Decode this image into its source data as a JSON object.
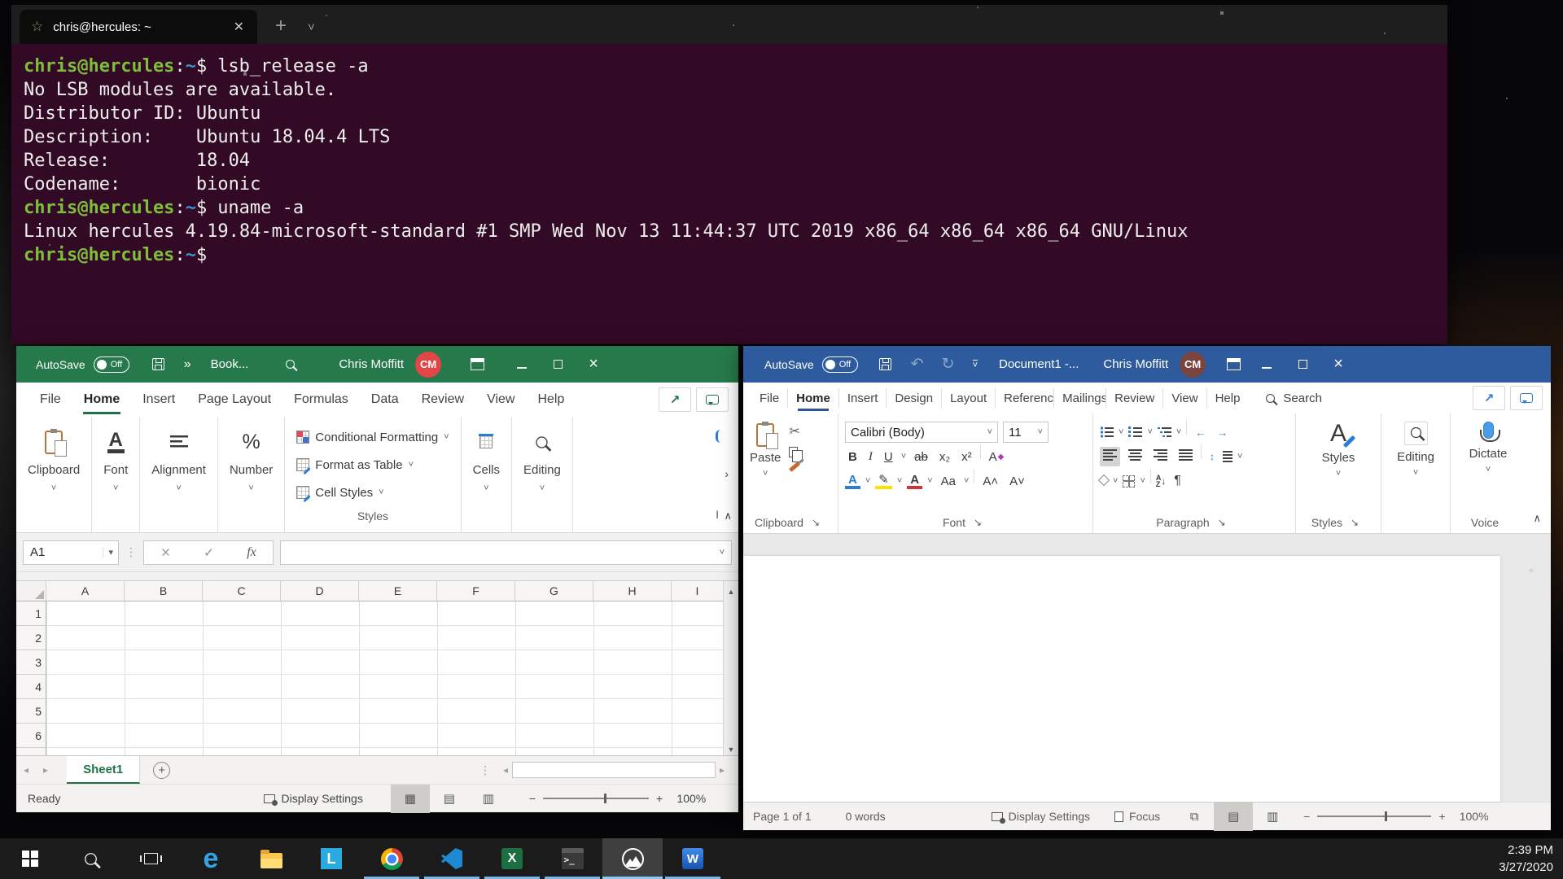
{
  "terminal": {
    "tab": {
      "title": "chris@hercules: ~",
      "close_glyph": "✕"
    },
    "newtab_glyph": "+",
    "menu_glyph": "˅",
    "prompt": {
      "user": "chris@hercules",
      "colon": ":",
      "path": "~",
      "symbol": "$"
    },
    "lines": [
      {
        "cmd": "lsb_release -a"
      },
      {
        "text": "No LSB modules are available."
      },
      {
        "text": "Distributor ID: Ubuntu"
      },
      {
        "text": "Description:    Ubuntu 18.04.4 LTS"
      },
      {
        "text": "Release:        18.04"
      },
      {
        "text": "Codename:       bionic"
      },
      {
        "cmd": "uname -a"
      },
      {
        "text": "Linux hercules 4.19.84-microsoft-standard #1 SMP Wed Nov 13 11:44:37 UTC 2019 x86_64 x86_64 x86_64 GNU/Linux"
      },
      {
        "cmd": ""
      }
    ]
  },
  "excel": {
    "accent": "#217346",
    "titlebar": {
      "autosave_label": "AutoSave",
      "autosave_state": "Off",
      "overflow_glyph": "»",
      "doc_title": "Book...",
      "user": "Chris Moffitt",
      "avatar": "CM",
      "avatar_color": "#e24649"
    },
    "tabs": [
      "File",
      "Home",
      "Insert",
      "Page Layout",
      "Formulas",
      "Data",
      "Review",
      "View",
      "Help"
    ],
    "ribbon": {
      "clipboard_label": "Clipboard",
      "font_label": "Font",
      "alignment_label": "Alignment",
      "number_label": "Number",
      "number_glyph": "%",
      "styles_buttons": [
        "Conditional Formatting",
        "Format as Table",
        "Cell Styles"
      ],
      "styles_group_label": "Styles",
      "cells_label": "Cells",
      "editing_label": "Editing",
      "overflow_label": "I"
    },
    "formula_bar": {
      "name_box": "A1",
      "cancel_glyph": "✕",
      "enter_glyph": "✓",
      "fx_glyph": "fx",
      "value": ""
    },
    "grid": {
      "columns": [
        "A",
        "B",
        "C",
        "D",
        "E",
        "F",
        "G",
        "H",
        "I"
      ],
      "rows": [
        "1",
        "2",
        "3",
        "4",
        "5",
        "6"
      ]
    },
    "sheet_bar": {
      "sheet": "Sheet1",
      "add_glyph": "+"
    },
    "status": {
      "mode": "Ready",
      "display_settings": "Display Settings",
      "zoom_out": "−",
      "zoom_in": "+",
      "zoom": "100%"
    }
  },
  "word": {
    "accent": "#2b579a",
    "titlebar": {
      "autosave_label": "AutoSave",
      "autosave_state": "Off",
      "undo_glyph": "↶",
      "redo_glyph": "↻",
      "doc_title": "Document1  -...",
      "user": "Chris Moffitt",
      "avatar": "CM",
      "avatar_color": "#7b453f"
    },
    "tabs": [
      "File",
      "Home",
      "Insert",
      "Design",
      "Layout",
      "References",
      "Mailings",
      "Review",
      "View",
      "Help"
    ],
    "search_label": "Search",
    "ribbon": {
      "paste_label": "Paste",
      "clipboard_label": "Clipboard",
      "font_name": "Calibri (Body)",
      "font_size": "11",
      "bold": "B",
      "italic": "I",
      "underline": "U",
      "strike": "ab",
      "subscript": "x₂",
      "superscript": "x²",
      "case": "Aa",
      "grow": "A˄",
      "shrink": "A˅",
      "texteffect": "A",
      "fontcolor": "A",
      "font_label": "Font",
      "paragraph_label": "Paragraph",
      "sort_a": "A",
      "sort_z": "Z",
      "sort_arrow": "↓",
      "pilcrow": "¶",
      "spacing_glyph": "↕",
      "indent_dec": "←",
      "indent_inc": "→",
      "styles_button": "Styles",
      "styles_label": "Styles",
      "editing_label": "Editing",
      "dictate_label": "Dictate",
      "voice_label": "Voice"
    },
    "status": {
      "page": "Page 1 of 1",
      "words": "0 words",
      "display_settings": "Display Settings",
      "focus": "Focus",
      "zoom_out": "−",
      "zoom_in": "+",
      "zoom": "100%"
    }
  },
  "taskbar": {
    "items": [
      {
        "name": "start"
      },
      {
        "name": "search"
      },
      {
        "name": "task-view"
      },
      {
        "name": "edge"
      },
      {
        "name": "file-explorer"
      },
      {
        "name": "l-app",
        "label": "L"
      },
      {
        "name": "chrome"
      },
      {
        "name": "vscode"
      },
      {
        "name": "excel",
        "label": "X"
      },
      {
        "name": "terminal"
      },
      {
        "name": "photos"
      },
      {
        "name": "word",
        "label": "W"
      }
    ],
    "clock": {
      "time": "2:39 PM",
      "date": "3/27/2020"
    }
  }
}
